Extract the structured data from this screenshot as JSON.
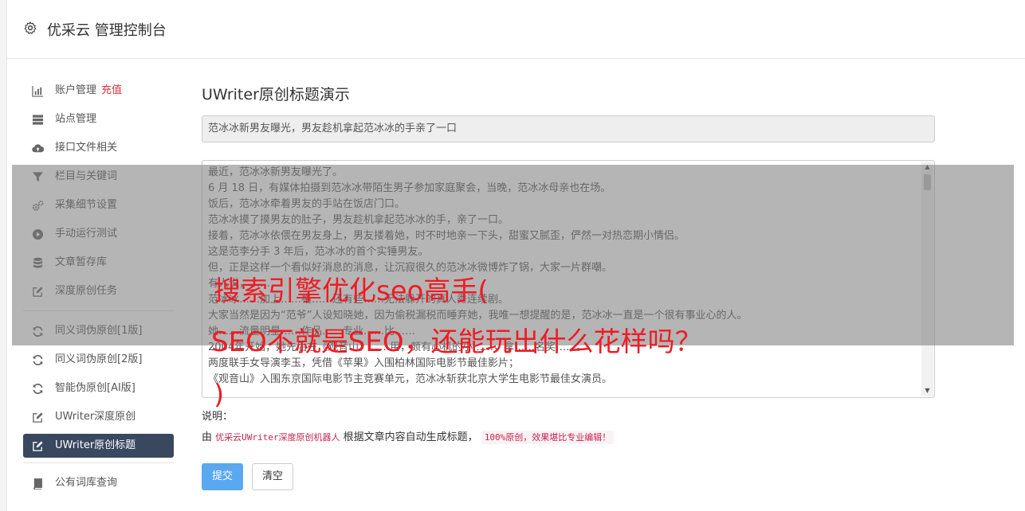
{
  "header": {
    "title": "优采云 管理控制台",
    "icon": "gear-icon"
  },
  "sidebar": {
    "items": [
      {
        "label": "账户管理",
        "badge": "充值",
        "icon": "bar-chart-icon"
      },
      {
        "label": "站点管理",
        "icon": "server-icon"
      },
      {
        "label": "接口文件相关",
        "icon": "cloud-upload-icon"
      },
      {
        "label": "栏目与关键词",
        "icon": "filter-icon"
      },
      {
        "label": "采集细节设置",
        "icon": "cogs-icon"
      },
      {
        "label": "手动运行测试",
        "icon": "play-circle-icon"
      },
      {
        "label": "文章暂存库",
        "icon": "database-icon"
      },
      {
        "label": "深度原创任务",
        "icon": "edit-icon"
      }
    ],
    "items2": [
      {
        "label": "同义词伪原创[1版]",
        "icon": "refresh-icon"
      },
      {
        "label": "同义词伪原创[2版]",
        "icon": "refresh-icon"
      },
      {
        "label": "智能伪原创[AI版]",
        "icon": "refresh-icon"
      },
      {
        "label": "UWriter深度原创",
        "icon": "edit-icon"
      },
      {
        "label": "UWriter原创标题",
        "icon": "edit-icon",
        "active": true
      }
    ],
    "items3": [
      {
        "label": "公有词库查询",
        "icon": "book-icon"
      }
    ]
  },
  "main": {
    "heading": "UWriter原创标题演示",
    "title_value": "范冰冰新男友曝光，男友趁机拿起范冰冰的手亲了一口",
    "content_lines": [
      "最近，范冰冰新男友曝光了。",
      "6 月 18 日，有媒体拍摄到范冰冰带陌生男子参加家庭聚会，当晚，范冰冰母亲也在场。",
      "饭后，范冰冰牵着男友的手站在饭店门口。",
      "范冰冰摸了摸男友的肚子，男友趁机拿起范冰冰的手，亲了一口。",
      "接着，范冰冰依偎在男友身上，男友搂着她，时不时地亲一下头，甜蜜又腻歪，俨然一对热恋期小情侣。",
      "这是范李分手 3 年后，范冰冰的首个实锤男友。",
      "但，正是这样一个看似好消息的消息，让沉寂很久的范冰冰微博炸了锅，大家一片群嘲。",
      "有人说，……",
      "范冰冰……加上……格……还有些……无法躲开的真人秀连续剧。",
      "大家当然是因为“范爷”人设知晓她，因为偷税漏税而睡弃她，我唯一想提醒的是，范冰冰一直是一个很有事业心的人。",
      "她……流量明星……作品……专业……比……",
      "2004年开始，她先后在《观音山》……用，颇有心机的小……，拿……名奖……。",
      "两度联手女导演李玉，凭借《苹果》入围柏林国际电影节最佳影片；",
      "《观音山》入围东京国际电影节主竞赛单元，范冰冰斩获北京大学生电影节最佳女演员。"
    ],
    "note_label": "说明：",
    "note_prefix": "由",
    "note_robot": "优采云UWriter深度原创机器人",
    "note_middle": "根据文章内容自动生成标题，",
    "note_badge": "100%原创，效果堪比专业编辑！",
    "submit_label": "提交",
    "clear_label": "清空"
  },
  "watermark": {
    "line1": "搜索引擎优化seo高手(",
    "line2": "SEO不就是SEO，还能玩出什么花样吗？",
    "line3": ")"
  },
  "colors": {
    "active_nav": "#39475f",
    "primary_button": "#5aa8ef",
    "recharge": "#e0303b",
    "watermark": "#ee1c25"
  }
}
